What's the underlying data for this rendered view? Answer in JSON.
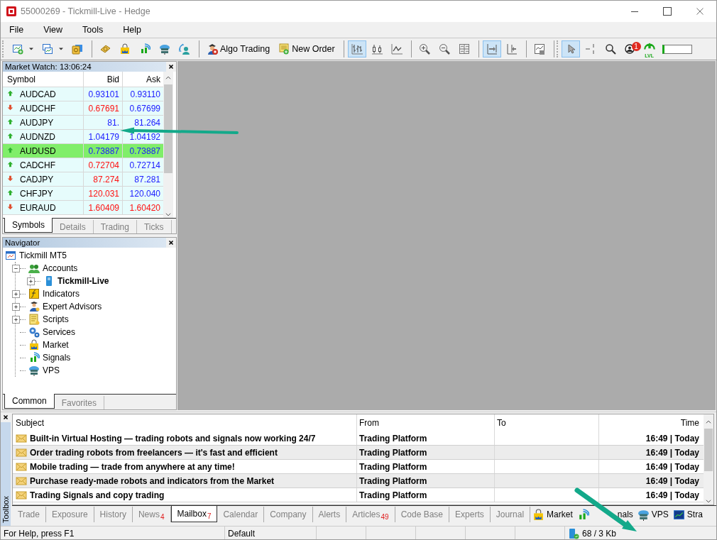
{
  "window": {
    "title": "55000269 - Tickmill-Live - Hedge"
  },
  "menu": [
    "File",
    "View",
    "Tools",
    "Help"
  ],
  "toolbar": {
    "groups": [
      [
        {
          "selected": false,
          "dropdown": true
        },
        {
          "selected": false,
          "dropdown": true
        },
        {
          "selected": false
        }
      ],
      [
        {
          "selected": false
        },
        {
          "selected": false
        },
        {
          "selected": false
        },
        {
          "selected": false
        },
        {
          "selected": false
        }
      ],
      [
        {
          "label": "Algo Trading",
          "selected": false
        },
        {
          "label": "New Order",
          "selected": false
        }
      ],
      [
        {
          "selected": true
        },
        {
          "selected": false
        },
        {
          "selected": false
        }
      ],
      [
        {
          "selected": false
        },
        {
          "selected": false
        },
        {
          "selected": false
        }
      ],
      [
        {
          "selected": true
        },
        {
          "selected": false
        }
      ],
      [
        {
          "selected": false
        }
      ],
      [
        {
          "selected": true
        },
        {
          "selected": false
        },
        {
          "selected": false
        },
        {
          "selected": false,
          "badge": "1"
        },
        {
          "selected": false,
          "label": "LVL"
        }
      ]
    ]
  },
  "market_watch": {
    "title": "Market Watch: 13:06:24",
    "columns": [
      "Symbol",
      "Bid",
      "Ask"
    ],
    "rows": [
      {
        "symbol": "AUDCAD",
        "rising": true,
        "bid": "0.93101",
        "bid_rising": true,
        "ask": "0.93110",
        "ask_rising": true,
        "selected": false
      },
      {
        "symbol": "AUDCHF",
        "rising": false,
        "bid": "0.67691",
        "bid_rising": false,
        "ask": "0.67699",
        "ask_rising": true,
        "selected": false
      },
      {
        "symbol": "AUDJPY",
        "rising": true,
        "bid": "81.",
        "bid_rising": true,
        "ask": "81.264",
        "ask_rising": true,
        "selected": false
      },
      {
        "symbol": "AUDNZD",
        "rising": true,
        "bid": "1.04179",
        "bid_rising": true,
        "ask": "1.04192",
        "ask_rising": true,
        "selected": false
      },
      {
        "symbol": "AUDUSD",
        "rising": true,
        "bid": "0.73887",
        "bid_rising": true,
        "ask": "0.73887",
        "ask_rising": true,
        "selected": true
      },
      {
        "symbol": "CADCHF",
        "rising": true,
        "bid": "0.72704",
        "bid_rising": false,
        "ask": "0.72714",
        "ask_rising": true,
        "selected": false
      },
      {
        "symbol": "CADJPY",
        "rising": false,
        "bid": "87.274",
        "bid_rising": false,
        "ask": "87.281",
        "ask_rising": true,
        "selected": false
      },
      {
        "symbol": "CHFJPY",
        "rising": true,
        "bid": "120.031",
        "bid_rising": false,
        "ask": "120.040",
        "ask_rising": true,
        "selected": false
      },
      {
        "symbol": "EURAUD",
        "rising": false,
        "bid": "1.60409",
        "bid_rising": false,
        "ask": "1.60420",
        "ask_rising": false,
        "selected": false
      }
    ],
    "tabs": [
      {
        "label": "Symbols",
        "selected": true
      },
      {
        "label": "Details",
        "selected": false
      },
      {
        "label": "Trading",
        "selected": false
      },
      {
        "label": "Ticks",
        "selected": false
      }
    ]
  },
  "navigator": {
    "title": "Navigator",
    "tree": [
      {
        "label": "Tickmill MT5",
        "kind": "terminal",
        "children": [
          {
            "label": "Accounts",
            "kind": "accounts",
            "expanded": true,
            "children": [
              {
                "label": "Tickmill-Live",
                "kind": "server",
                "expanded": false
              }
            ]
          },
          {
            "label": "Indicators",
            "kind": "indicators",
            "expanded": false
          },
          {
            "label": "Expert Advisors",
            "kind": "experts",
            "expanded": false
          },
          {
            "label": "Scripts",
            "kind": "scripts",
            "expanded": false
          },
          {
            "label": "Services",
            "kind": "services"
          },
          {
            "label": "Market",
            "kind": "market"
          },
          {
            "label": "Signals",
            "kind": "signals"
          },
          {
            "label": "VPS",
            "kind": "vps"
          }
        ]
      }
    ],
    "tabs": [
      {
        "label": "Common",
        "selected": true
      },
      {
        "label": "Favorites",
        "selected": false
      }
    ]
  },
  "toolbox": {
    "side_label": "Toolbox",
    "columns": [
      "Subject",
      "From",
      "To",
      "Time"
    ],
    "rows": [
      {
        "subject": "Built-in Virtual Hosting — trading robots and signals now working 24/7",
        "from": "Trading Platform",
        "time": "16:49 | Today"
      },
      {
        "subject": "Order trading robots from freelancers — it's fast and efficient",
        "from": "Trading Platform",
        "time": "16:49 | Today"
      },
      {
        "subject": "Mobile trading — trade from anywhere at any time!",
        "from": "Trading Platform",
        "time": "16:49 | Today"
      },
      {
        "subject": "Purchase ready-made robots and indicators from the Market",
        "from": "Trading Platform",
        "time": "16:49 | Today"
      },
      {
        "subject": "Trading Signals and copy trading",
        "from": "Trading Platform",
        "time": "16:49 | Today"
      }
    ],
    "tabs": [
      {
        "label": "Trade",
        "kind": "text",
        "selected": false
      },
      {
        "label": "Exposure",
        "kind": "text",
        "selected": false
      },
      {
        "label": "History",
        "kind": "text",
        "selected": false
      },
      {
        "label": "News",
        "kind": "text",
        "badge": "4",
        "selected": false
      },
      {
        "label": "Mailbox",
        "kind": "text",
        "badge": "7",
        "selected": true
      },
      {
        "label": "Calendar",
        "kind": "text",
        "selected": false
      },
      {
        "label": "Company",
        "kind": "text",
        "selected": false
      },
      {
        "label": "Alerts",
        "kind": "text",
        "selected": false
      },
      {
        "label": "Articles",
        "kind": "text",
        "badge": "49",
        "selected": false
      },
      {
        "label": "Code Base",
        "kind": "text",
        "selected": false
      },
      {
        "label": "Experts",
        "kind": "text",
        "selected": false
      },
      {
        "label": "Journal",
        "kind": "text",
        "selected": false
      },
      {
        "label": "Market",
        "kind": "icon",
        "selected": false
      },
      {
        "label": "nals",
        "kind": "icon",
        "selected": false
      },
      {
        "label": "VPS",
        "kind": "icon",
        "selected": false
      },
      {
        "label": "Stra",
        "kind": "icon",
        "selected": false
      }
    ]
  },
  "status_bar": {
    "help": "For Help, press F1",
    "profile": "Default",
    "traffic": "68 / 3 Kb"
  },
  "annotations": [
    {
      "kind": "arrow"
    },
    {
      "kind": "arrow"
    }
  ]
}
